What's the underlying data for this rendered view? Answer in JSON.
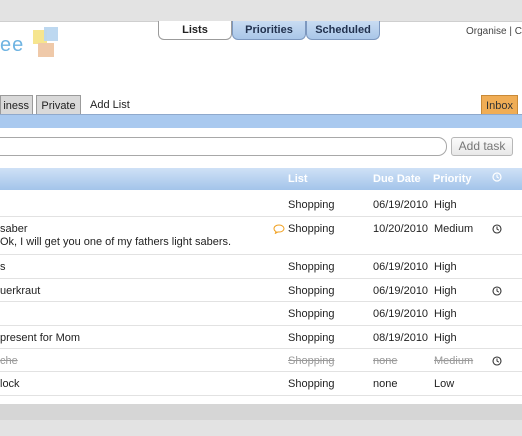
{
  "header": {
    "logo_text": "ee",
    "tabs": [
      "Lists",
      "Priorities",
      "Scheduled"
    ],
    "right_link": "Organise | C"
  },
  "list_tabs": {
    "business": "iness",
    "private": "Private",
    "add_list": "Add List",
    "inbox": "Inbox"
  },
  "task_entry": {
    "value": "",
    "button": "Add task"
  },
  "table": {
    "columns": {
      "list": "List",
      "due": "Due Date",
      "priority": "Priority"
    },
    "rows": [
      {
        "title": "",
        "list": "Shopping",
        "due": "06/19/2010",
        "priority": "High",
        "clock": false,
        "note": "",
        "done": false
      },
      {
        "title": "saber",
        "list": "Shopping",
        "due": "10/20/2010",
        "priority": "Medium",
        "clock": true,
        "note": "Ok, I will get you one of my fathers light sabers.",
        "done": false
      },
      {
        "title": "s",
        "list": "Shopping",
        "due": "06/19/2010",
        "priority": "High",
        "clock": false,
        "note": "",
        "done": false
      },
      {
        "title": "uerkraut",
        "list": "Shopping",
        "due": "06/19/2010",
        "priority": "High",
        "clock": true,
        "note": "",
        "done": false
      },
      {
        "title": "",
        "list": "Shopping",
        "due": "06/19/2010",
        "priority": "High",
        "clock": false,
        "note": "",
        "done": false
      },
      {
        "title": "present for Mom",
        "list": "Shopping",
        "due": "08/19/2010",
        "priority": "High",
        "clock": false,
        "note": "",
        "done": false
      },
      {
        "title": "che",
        "list": "Shopping",
        "due": "none",
        "priority": "Medium",
        "clock": true,
        "note": "",
        "done": true
      },
      {
        "title": "lock",
        "list": "Shopping",
        "due": "none",
        "priority": "Low",
        "clock": false,
        "note": "",
        "done": false
      }
    ]
  },
  "icons": {
    "clock": "clock-icon",
    "comment": "speech-bubble-icon"
  },
  "colors": {
    "accent_blue": "#a9c9ef",
    "inbox": "#f0ad55",
    "comment_icon": "#f0a020"
  }
}
